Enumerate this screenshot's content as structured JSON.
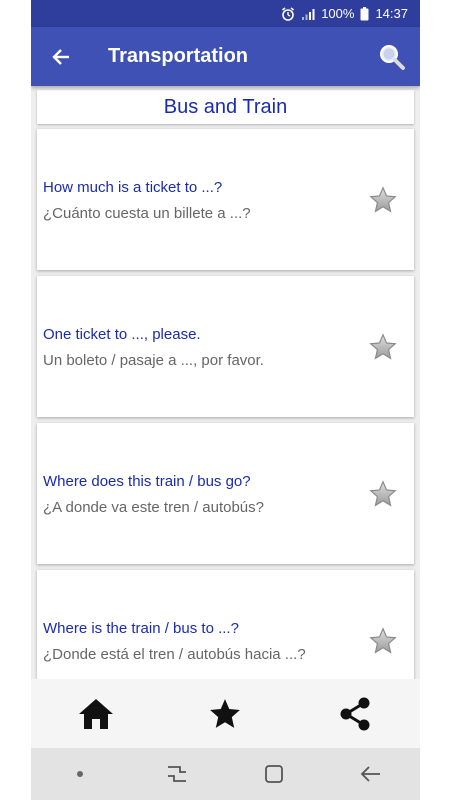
{
  "status_bar": {
    "battery": "100%",
    "time": "14:37",
    "icons": [
      "alarm-icon",
      "signal-icon",
      "battery-icon"
    ]
  },
  "app_bar": {
    "title": "Transportation",
    "back_icon": "back-arrow-icon",
    "search_icon": "search-icon"
  },
  "section": {
    "title": "Bus and Train"
  },
  "phrases": [
    {
      "en": "How much is a ticket to ...?",
      "es": "¿Cuánto cuesta un billete a ...?"
    },
    {
      "en": "One ticket to ..., please.",
      "es": "Un boleto / pasaje a ..., por favor."
    },
    {
      "en": "Where does this train / bus go?",
      "es": "¿A donde va este tren / autobús?"
    },
    {
      "en": "Where is the train / bus to ...?",
      "es": "¿Donde está el tren / autobús hacia ...?"
    }
  ],
  "bottom_nav": {
    "items": [
      "home-icon",
      "star-icon",
      "share-icon"
    ]
  },
  "system_nav": {
    "items": [
      "dot-icon",
      "recent-apps-icon",
      "home-square-icon",
      "back-icon"
    ]
  },
  "colors": {
    "app_bar": "#3f51b5",
    "status_bar": "#2f3d9c",
    "english_text": "#1a2bb0",
    "spanish_text": "#666666"
  }
}
